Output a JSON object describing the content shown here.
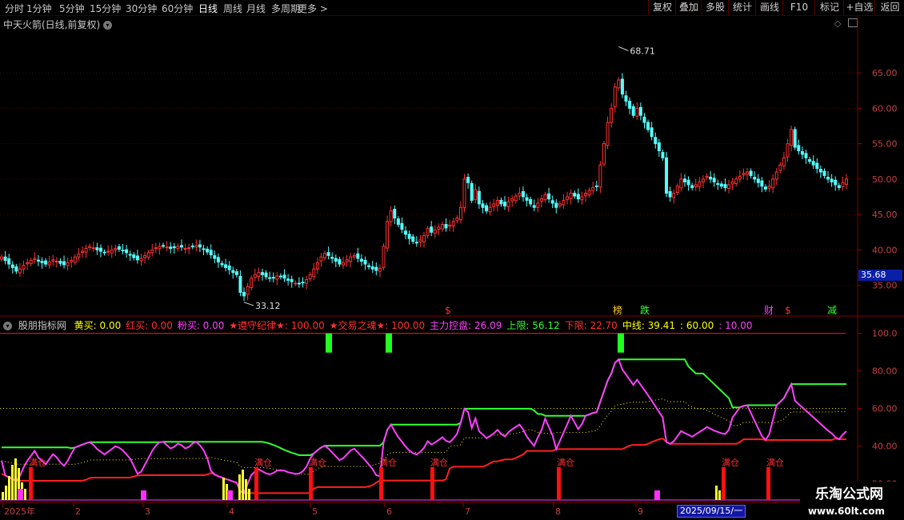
{
  "toolbar": {
    "timeframes": [
      "分时",
      "1分钟",
      "5分钟",
      "15分钟",
      "30分钟",
      "60分钟",
      "日线",
      "周线",
      "月线",
      "多周期",
      "更多 >"
    ],
    "active_timeframe": "日线",
    "right_buttons": [
      "复权",
      "叠加",
      "多股",
      "统计",
      "画线",
      "F10",
      "标记",
      "+自选",
      "返回"
    ]
  },
  "main_chart": {
    "title": "中天火箭(日线,前复权)",
    "high_label": "68.71",
    "low_label": "33.12",
    "current_price": "35.68",
    "price_axis": [
      "65.00",
      "60.00",
      "55.00",
      "50.00",
      "45.00",
      "40.00",
      "35.00"
    ],
    "event_markers": [
      "$",
      "榜",
      "跌",
      "财",
      "$",
      "减"
    ]
  },
  "indicator": {
    "name": "股朋指标网",
    "fields": [
      {
        "label": "黄买: 0.00",
        "color": "#ffff00"
      },
      {
        "label": "红买: 0.00",
        "color": "#ff3030"
      },
      {
        "label": "粉买: 0.00",
        "color": "#ff40ff"
      },
      {
        "label": "★遵守纪律★: 100.00",
        "color": "#ff3030"
      },
      {
        "label": "★交易之魂★: 100.00",
        "color": "#ff3030"
      },
      {
        "label": "主力控盘: 26.09",
        "color": "#ff40ff"
      },
      {
        "label": "上限: 56.12",
        "color": "#30ff30"
      },
      {
        "label": "下限: 22.70",
        "color": "#ff3030"
      },
      {
        "label": "中线: 39.41",
        "color": "#ffff00"
      },
      {
        "label": ": 60.00",
        "color": "#ffff00"
      },
      {
        "label": ": 10.00",
        "color": "#ff40ff"
      }
    ],
    "axis": [
      "100.0",
      "80.00",
      "60.00",
      "40.00",
      "20.00"
    ],
    "full_label": "满仓"
  },
  "time_axis": {
    "labels": [
      "2025年",
      "2",
      "3",
      "4",
      "5",
      "6",
      "7",
      "8",
      "9"
    ],
    "cursor_date": "2025/09/15/一"
  },
  "watermark": {
    "line1": "乐淘公式网",
    "line2": "www.60lt.com"
  },
  "colors": {
    "up": "#ff3232",
    "down": "#54ffff",
    "upper": "#30ff30",
    "lower": "#ff2020",
    "control": "#ff40ff",
    "mid": "#ffff00"
  },
  "chart_data": {
    "type": "candlestick",
    "y_range": [
      31,
      71
    ],
    "closes": [
      39,
      38.5,
      38,
      37.5,
      37,
      37.3,
      37.8,
      38.2,
      38.5,
      38.8,
      38.4,
      38.2,
      38,
      38.3,
      38.6,
      38.4,
      38.1,
      37.9,
      38.2,
      38.5,
      39,
      39.4,
      39.8,
      40.2,
      40.5,
      40.3,
      40,
      39.8,
      39.6,
      39.8,
      40,
      40.2,
      40.1,
      39.9,
      39.6,
      39.3,
      38.9,
      38.6,
      38.8,
      39.2,
      39.6,
      40,
      40.3,
      40.5,
      40.6,
      40.4,
      40.2,
      40.3,
      40.5,
      40.4,
      40.2,
      40.3,
      40.5,
      40.6,
      40.4,
      40.1,
      39.7,
      39.3,
      38.8,
      38.3,
      37.9,
      37.5,
      37.2,
      36.8,
      36.5,
      34,
      33.5,
      34.8,
      36,
      36.5,
      36.8,
      36.5,
      36.2,
      36,
      36.1,
      36.3,
      36.2,
      36,
      35.7,
      35.5,
      35.3,
      35.2,
      35.4,
      35.8,
      36.5,
      37.3,
      38.2,
      39,
      39.5,
      39.2,
      38.8,
      38.4,
      38,
      38.2,
      38.6,
      39,
      39.2,
      38.8,
      38.4,
      38,
      37.6,
      37.3,
      37.1,
      37.4,
      40.5,
      44,
      45.5,
      44.5,
      43.6,
      42.9,
      42.2,
      41.6,
      41.2,
      41,
      41.4,
      42,
      43,
      42.5,
      42.8,
      43.2,
      43.6,
      43.1,
      43.5,
      44,
      44.5,
      46,
      50,
      49.5,
      47,
      48.5,
      46.5,
      46,
      45.5,
      46,
      46.5,
      47,
      46.5,
      46.2,
      46.8,
      47.2,
      47.6,
      48,
      47.5,
      47,
      46.5,
      46,
      46.6,
      47.2,
      47.8,
      47.2,
      46.6,
      46,
      46.5,
      47,
      47.5,
      48,
      47.6,
      47.2,
      47.5,
      48,
      48.4,
      48.8,
      49,
      52,
      55,
      58,
      60,
      63,
      64,
      62,
      61,
      60,
      59,
      60,
      59,
      58,
      57,
      56,
      55,
      54,
      53,
      48,
      47.5,
      48,
      49,
      50,
      49.6,
      49.2,
      48.8,
      49.2,
      49.6,
      50,
      50.4,
      50,
      49.6,
      49.3,
      49,
      48.8,
      49.2,
      49.6,
      50,
      50.4,
      50.8,
      51,
      50.5,
      50,
      49.5,
      49,
      48.6,
      49,
      50,
      51,
      52,
      53,
      55,
      57,
      54.5,
      54,
      53.5,
      53,
      52.5,
      52,
      51.5,
      51,
      50.5,
      50,
      49.6,
      49.2,
      48.8,
      49.5,
      50
    ]
  }
}
